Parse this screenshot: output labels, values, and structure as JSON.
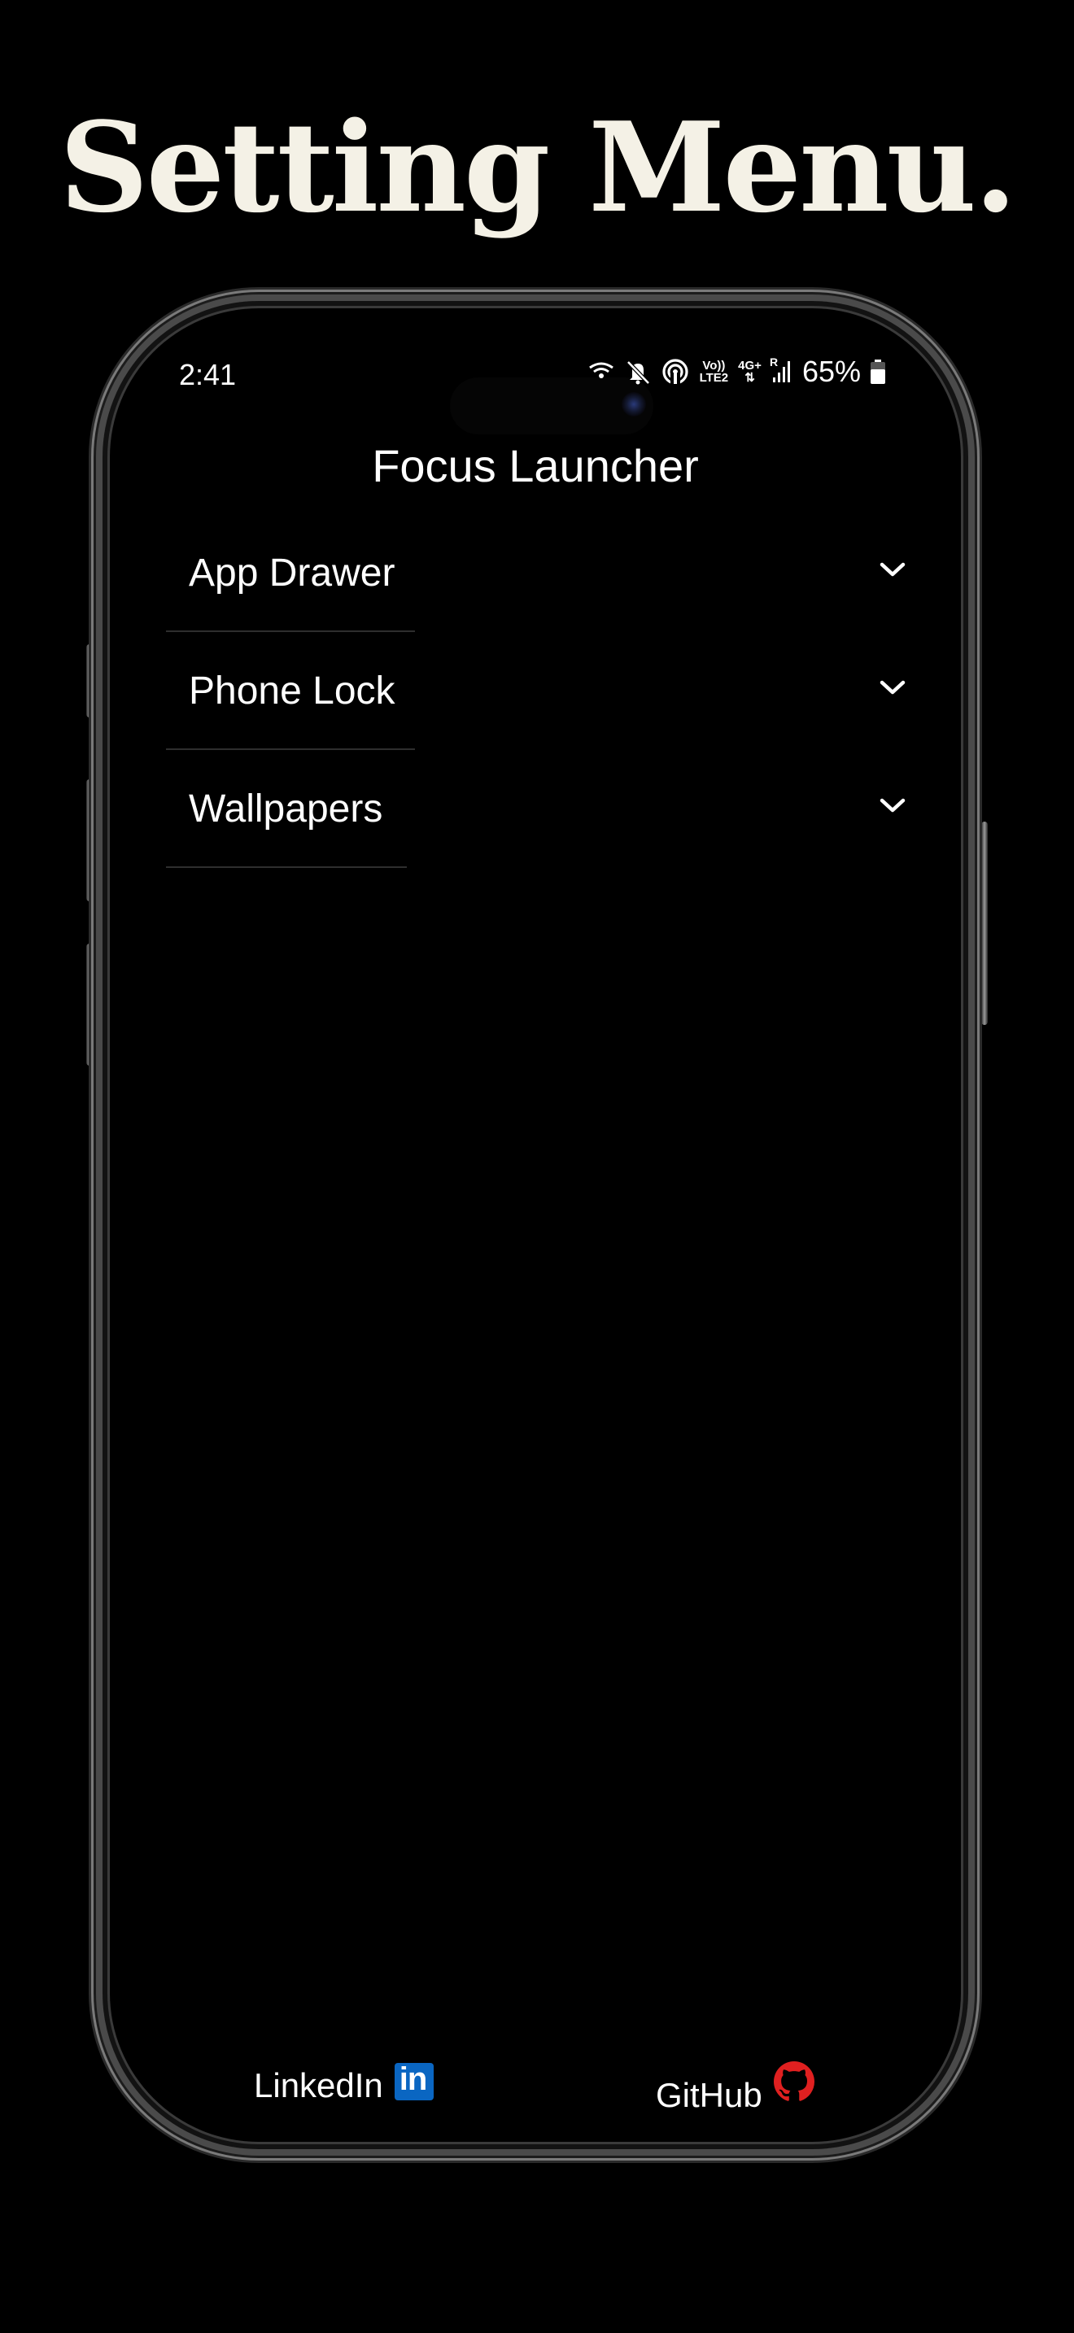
{
  "headline": "Setting Menu.",
  "status_bar": {
    "time": "2:41",
    "volte_top": "Vo))",
    "volte_bottom": "LTE2",
    "network_type": "4G+",
    "roaming": "R",
    "battery": "65%",
    "icons": [
      "hotspot-icon",
      "mute-icon",
      "wifi-calling-icon",
      "signal-icon",
      "battery-icon"
    ]
  },
  "app": {
    "title": "Focus Launcher",
    "menu": [
      {
        "label": "App Drawer"
      },
      {
        "label": "Phone Lock"
      },
      {
        "label": "Wallpapers"
      }
    ]
  },
  "footer": {
    "linkedin_label": "LinkedIn",
    "github_label": "GitHub",
    "linkedin_icon_text": "in"
  },
  "colors": {
    "background": "#000000",
    "headline": "#f4f1e6",
    "linkedin_blue": "#0a66c2",
    "github_red": "#e02020"
  }
}
